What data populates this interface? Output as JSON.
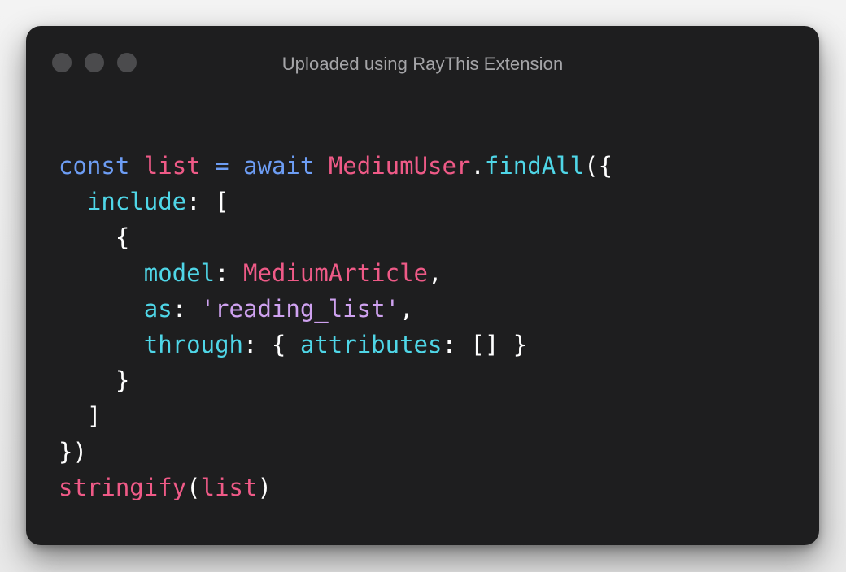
{
  "window": {
    "title": "Uploaded using RayThis Extension"
  },
  "colors": {
    "keyword": "#6d9df4",
    "variable": "#ef5a87",
    "property": "#4fd6e7",
    "string": "#cfa2f0",
    "punctuation": "#ffffff",
    "background": "#1e1e1f"
  },
  "code": {
    "line1": {
      "kw_const": "const",
      "var_list": "list",
      "eq": "=",
      "kw_await": "await",
      "cls": "MediumUser",
      "dot": ".",
      "method": "findAll",
      "open": "({"
    },
    "line2": {
      "prop": "include",
      "colon": ":",
      "bracket": "["
    },
    "line3": {
      "brace": "{"
    },
    "line4": {
      "prop": "model",
      "colon": ":",
      "value": "MediumArticle",
      "comma": ","
    },
    "line5": {
      "prop": "as",
      "colon": ":",
      "value": "'reading_list'",
      "comma": ","
    },
    "line6": {
      "prop": "through",
      "colon": ":",
      "open": "{",
      "inner_prop": "attributes",
      "inner_colon": ":",
      "inner_value": "[]",
      "close": "}"
    },
    "line7": {
      "brace": "}"
    },
    "line8": {
      "bracket": "]"
    },
    "line9": {
      "close": "})"
    },
    "line10": {
      "func": "stringify",
      "open": "(",
      "arg": "list",
      "close": ")"
    }
  }
}
